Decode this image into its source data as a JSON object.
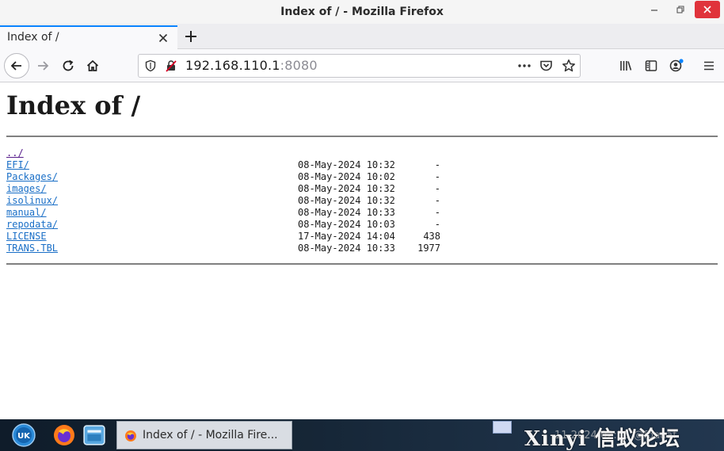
{
  "window": {
    "title": "Index of / - Mozilla Firefox"
  },
  "tabs": [
    {
      "label": "Index of /"
    }
  ],
  "urlbar": {
    "host": "192.168.110.1",
    "port": ":8080"
  },
  "page": {
    "heading": "Index of /",
    "entries": [
      {
        "name": "../",
        "date": "",
        "size": ""
      },
      {
        "name": "EFI/",
        "date": "08-May-2024 10:32",
        "size": "-"
      },
      {
        "name": "Packages/",
        "date": "08-May-2024 10:02",
        "size": "-"
      },
      {
        "name": "images/",
        "date": "08-May-2024 10:32",
        "size": "-"
      },
      {
        "name": "isolinux/",
        "date": "08-May-2024 10:32",
        "size": "-"
      },
      {
        "name": "manual/",
        "date": "08-May-2024 10:33",
        "size": "-"
      },
      {
        "name": "repodata/",
        "date": "08-May-2024 10:03",
        "size": "-"
      },
      {
        "name": "LICENSE",
        "date": "17-May-2024 14:04",
        "size": "438"
      },
      {
        "name": "TRANS.TBL",
        "date": "08-May-2024 10:33",
        "size": "1977"
      }
    ]
  },
  "taskbar": {
    "task_label": "Index of / - Mozilla Fire...",
    "watermark": "Xinyi 信蚁论坛",
    "clock": "11 2024 02:55 @fdaaaf"
  },
  "colors": {
    "link": "#1a6fc7",
    "visited_link": "#551a8b",
    "accent": "#0a84ff",
    "close_button": "#e0333b"
  },
  "icons": {
    "back": "arrow-left-icon",
    "forward": "arrow-right-icon",
    "reload": "reload-icon",
    "home": "home-icon",
    "tracking": "shield-icon",
    "insecure": "insecure-lock-icon",
    "page_actions": "more-icon",
    "pocket": "pocket-icon",
    "bookmark": "star-icon",
    "library": "library-icon",
    "sidebar": "sidebar-icon",
    "account": "account-icon",
    "menu": "hamburger-icon"
  }
}
